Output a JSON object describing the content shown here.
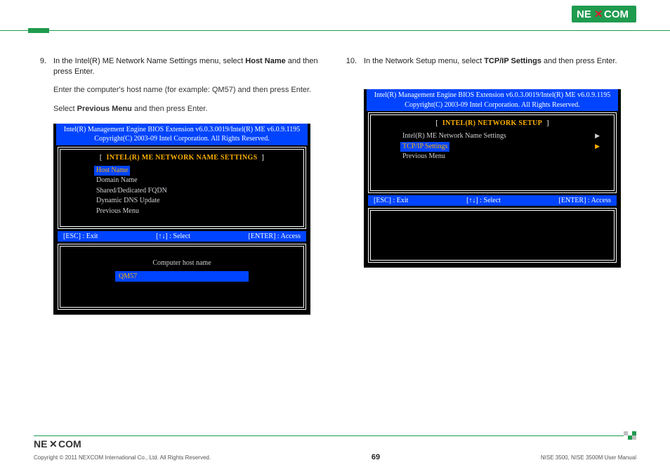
{
  "header": {
    "logo_text": "NEXCOM",
    "logo_x_color": "#D6202A",
    "logo_bg": "#1F9B4E"
  },
  "left": {
    "step_num": "9.",
    "step_text_a": "In the Intel(R) ME Network Name Settings menu, select ",
    "step_bold_1": "Host Name",
    "step_text_b": " and then press Enter.",
    "para1": "Enter the computer's host name (for example: QM57) and then press Enter.",
    "para2_a": "Select ",
    "para2_bold": "Previous Menu",
    "para2_b": " and then press Enter.",
    "bios": {
      "hdr1": "Intel(R) Management Engine BIOS Extension v6.0.3.0019/Intel(R) ME v6.0.9.1195",
      "hdr2": "Copyright(C) 2003-09 Intel Corporation. All Rights Reserved.",
      "title": "INTEL(R) ME NETWORK NAME SETTINGS",
      "items": [
        "Host Name",
        "Domain Name",
        "Shared/Dedicated FQDN",
        "Dynamic DNS Update",
        "Previous Menu"
      ],
      "status": {
        "esc": "[ESC] : Exit",
        "sel": "[↑↓] : Select",
        "enter": "[ENTER] : Access"
      },
      "input_label": "Computer host name",
      "input_value": "QM57"
    }
  },
  "right": {
    "step_num": "10.",
    "step_text_a": "In the Network Setup menu, select ",
    "step_bold_1": "TCP/IP Settings",
    "step_text_b": " and then press Enter.",
    "bios": {
      "hdr1": "Intel(R) Management Engine BIOS Extension v6.0.3.0019/Intel(R) ME v6.0.9.1195",
      "hdr2": "Copyright(C) 2003-09 Intel Corporation. All Rights Reserved.",
      "title": "INTEL(R) NETWORK SETUP",
      "items": [
        "Intel(R) ME Network Name Settings",
        "TCP/IP Settings",
        "Previous Menu"
      ],
      "status": {
        "esc": "[ESC] : Exit",
        "sel": "[↑↓] : Select",
        "enter": "[ENTER] : Access"
      }
    }
  },
  "footer": {
    "copyright": "Copyright © 2011 NEXCOM International Co., Ltd. All Rights Reserved.",
    "page": "69",
    "manual": "NISE 3500, NISE 3500M User Manual"
  }
}
